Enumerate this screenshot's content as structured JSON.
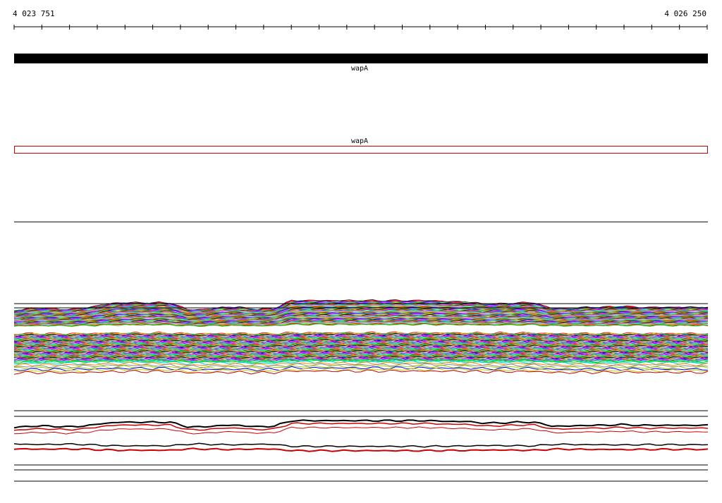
{
  "ruler": {
    "start_label": "4 023 751",
    "end_label": "4 026 250",
    "start": 4023751,
    "end": 4026250,
    "tick_count": 26
  },
  "tracks": {
    "gene_track": {
      "label": "wapA",
      "color": "#000000"
    },
    "annotation_track": {
      "label": "wapA",
      "color": "#cc0000"
    }
  },
  "coverage": {
    "palette": [
      "#ff0000",
      "#00cc00",
      "#0000ff",
      "#ff00ff",
      "#00cccc",
      "#cccc00",
      "#000000",
      "#ff8800",
      "#8800ff",
      "#00ff88",
      "#888888",
      "#ff6699",
      "#66ccff",
      "#99cc00"
    ],
    "profile": [
      0,
      0.2,
      0.2,
      0.1,
      0.2,
      0.5,
      0.7,
      0.7,
      0.7,
      0.7,
      0.1,
      0.1,
      0.3,
      0.3,
      0.1,
      0.2,
      0.9,
      0.9,
      0.9,
      0.9,
      0.9,
      0.9,
      0.9,
      0.9,
      0.9,
      0.8,
      0.8,
      0.6,
      0.6,
      0.7,
      0.7,
      0.2,
      0.2,
      0.3,
      0.3,
      0.4,
      0.3,
      0.3,
      0.3,
      0.3,
      0.3
    ],
    "summary_colors": [
      "#000000",
      "#cc0000"
    ]
  }
}
